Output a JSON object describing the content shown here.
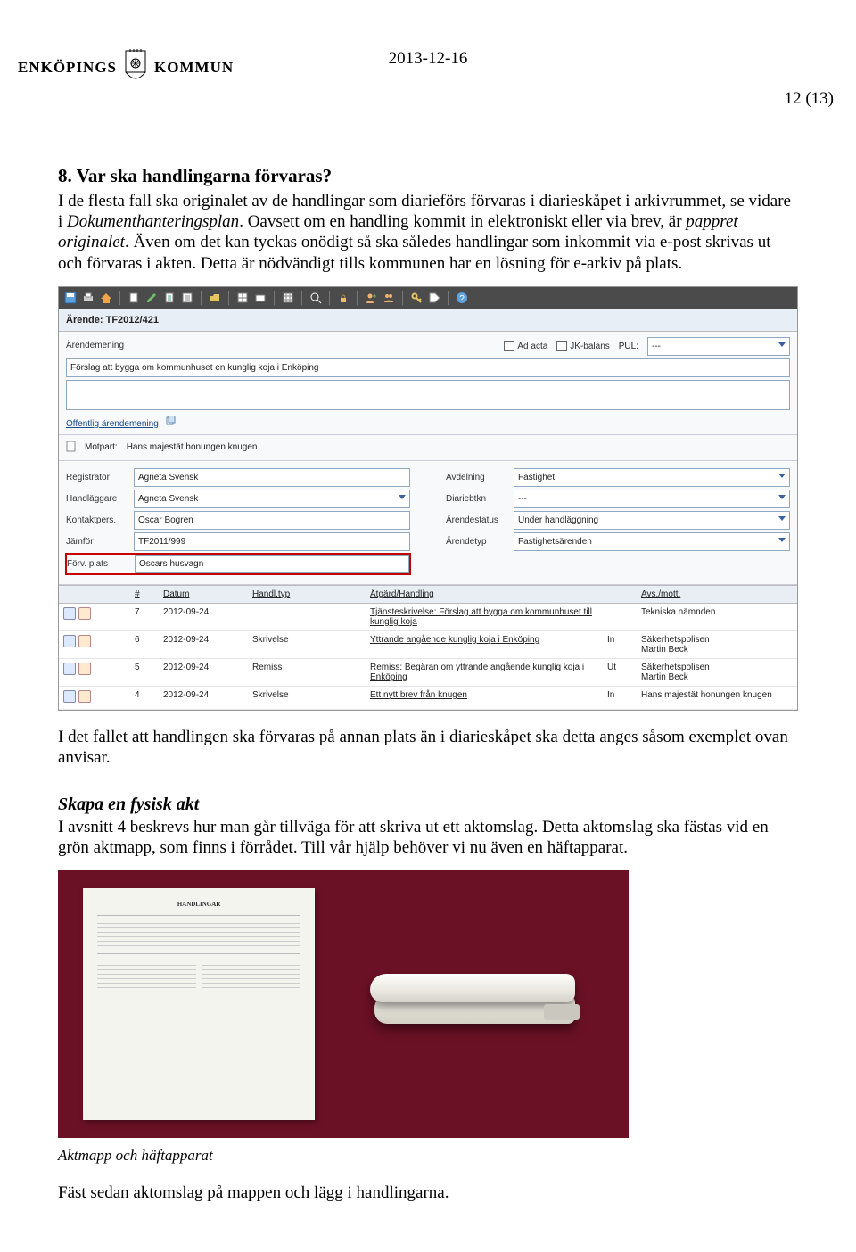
{
  "header": {
    "org_left": "ENKÖPINGS",
    "org_right": "KOMMUN",
    "page_indicator": "12 (13)",
    "date": "2013-12-16"
  },
  "section8": {
    "title": "8. Var ska handlingarna förvaras?",
    "para1_a": "I de flesta fall ska originalet av de handlingar som diarieförs förvaras i diarieskåpet i arkivrummet, se vidare i ",
    "para1_b_it": "Dokumenthanteringsplan",
    "para1_c": ". Oavsett om en handling kommit in elektroniskt eller via brev, är ",
    "para1_d_it": "pappret originalet",
    "para1_e": ". Även om det kan tyckas onödigt så ska således handlingar som inkommit via e-post skrivas ut och förvaras i akten. Detta är nödvändigt tills kommunen har en lösning för e-arkiv på plats."
  },
  "screenshot": {
    "case_label": "Ärende: TF2012/421",
    "labels": {
      "arendemening": "Ärendemening",
      "ad_acta": "Ad acta",
      "jk_balans": "JK-balans",
      "pul": "PUL:",
      "pul_val": "---",
      "offentlig": "Offentlig ärendemening",
      "motpart_lbl": "Motpart:",
      "motpart_val": "Hans majestät honungen knugen"
    },
    "mening_value": "Förslag att bygga om kommunhuset en kunglig koja i Enköping",
    "left_fields": {
      "registrator_lbl": "Registrator",
      "registrator_val": "Agneta Svensk",
      "handlaggare_lbl": "Handläggare",
      "handlaggare_val": "Agneta Svensk",
      "kontakt_lbl": "Kontaktpers.",
      "kontakt_val": "Oscar Bogren",
      "jamfor_lbl": "Jämför",
      "jamfor_val": "TF2011/999",
      "forv_lbl": "Förv. plats",
      "forv_val": "Oscars husvagn"
    },
    "right_fields": {
      "avd_lbl": "Avdelning",
      "avd_val": "Fastighet",
      "diar_lbl": "Diariebtkn",
      "diar_val": "---",
      "status_lbl": "Ärendestatus",
      "status_val": "Under handläggning",
      "typ_lbl": "Ärendetyp",
      "typ_val": "Fastighetsärenden"
    },
    "table": {
      "headers": {
        "num": "#",
        "datum": "Datum",
        "handl": "Handl.typ",
        "atgard": "Åtgärd/Handling",
        "avs": "Avs./mott."
      },
      "rows": [
        {
          "n": "7",
          "datum": "2012-09-24",
          "typ": "",
          "atgard": "Tjänsteskrivelse: Förslag att bygga om kommunhuset till kunglig koja",
          "dir": "",
          "avs": "Tekniska nämnden"
        },
        {
          "n": "6",
          "datum": "2012-09-24",
          "typ": "Skrivelse",
          "atgard": "Yttrande angående kunglig koja i Enköping",
          "dir": "In",
          "avs": "Säkerhetspolisen\nMartin Beck"
        },
        {
          "n": "5",
          "datum": "2012-09-24",
          "typ": "Remiss",
          "atgard": "Remiss: Begäran om yttrande angående kunglig koja i Enköping",
          "dir": "Ut",
          "avs": "Säkerhetspolisen\nMartin Beck"
        },
        {
          "n": "4",
          "datum": "2012-09-24",
          "typ": "Skrivelse",
          "atgard": "Ett nytt brev från knugen",
          "dir": "In",
          "avs": "Hans majestät honungen knugen"
        }
      ]
    }
  },
  "after_shot": {
    "para": "I det fallet att handlingen ska förvaras på annan plats än i diarieskåpet ska detta anges såsom exemplet ovan anvisar."
  },
  "skapa": {
    "title": "Skapa en fysisk akt",
    "para": "I avsnitt 4 beskrevs hur man går tillväga för att skriva ut ett aktomslag. Detta aktomslag ska fästas vid en grön aktmapp, som finns i förrådet. Till vår hjälp behöver vi nu även en häftapparat."
  },
  "photo_caption": "Aktmapp och häftapparat",
  "final_line": "Fäst sedan aktomslag på mappen och lägg i handlingarna."
}
